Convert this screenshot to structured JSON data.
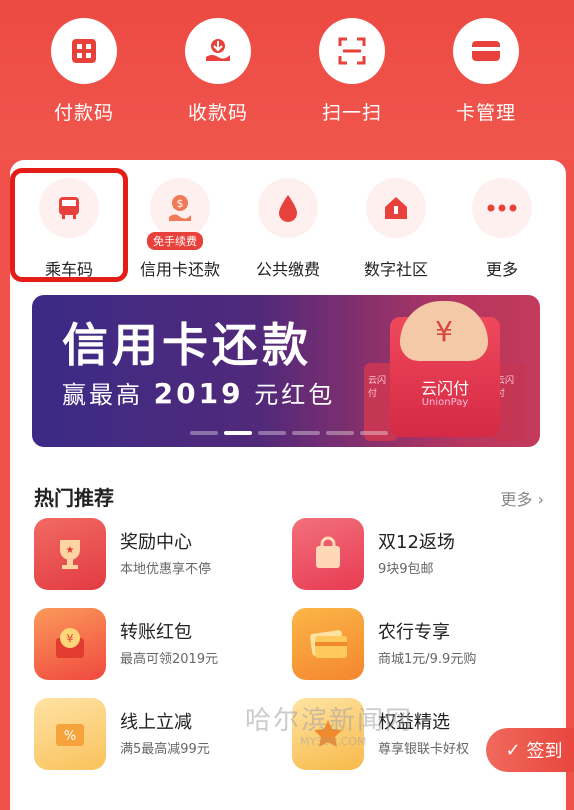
{
  "quick_actions": [
    {
      "label": "付款码",
      "icon": "grid-code-icon"
    },
    {
      "label": "收款码",
      "icon": "hand-receive-icon"
    },
    {
      "label": "扫一扫",
      "icon": "scan-icon"
    },
    {
      "label": "卡管理",
      "icon": "card-icon"
    }
  ],
  "services": [
    {
      "label": "乘车码",
      "icon": "train-icon"
    },
    {
      "label": "信用卡还款",
      "icon": "credit-repay-icon",
      "badge": "免手续费"
    },
    {
      "label": "公共缴费",
      "icon": "water-drop-icon"
    },
    {
      "label": "数字社区",
      "icon": "home-icon"
    },
    {
      "label": "更多",
      "icon": "more-icon"
    }
  ],
  "banner": {
    "title": "信用卡还款",
    "prefix": "赢最高",
    "amount": "2019",
    "suffix": "元红包",
    "brand": "云闪付",
    "brand_sub": "UnionPay",
    "side_brand": "云闪付",
    "active_dot": 1,
    "dot_count": 6
  },
  "section": {
    "title": "热门推荐",
    "more": "更多"
  },
  "recommendations": [
    {
      "title": "奖励中心",
      "desc": "本地优惠享不停",
      "icon": "trophy-icon",
      "color": "#e9434b"
    },
    {
      "title": "双12返场",
      "desc": "9块9包邮",
      "icon": "shopping-bag-icon",
      "color": "#ee4a5c"
    },
    {
      "title": "转账红包",
      "desc": "最高可领2019元",
      "icon": "red-envelope-icon",
      "color": "#f2644a"
    },
    {
      "title": "农行专享",
      "desc": "商城1元/9.9元购",
      "icon": "bank-card-icon",
      "color": "#f6a33a"
    },
    {
      "title": "线上立减",
      "desc": "满5最高减99元",
      "icon": "coupon-icon",
      "color": "#f6c94a"
    },
    {
      "title": "权益精选",
      "desc": "尊享银联卡好权",
      "icon": "benefit-icon",
      "color": "#f7c24a"
    }
  ],
  "signin": {
    "label": "签到"
  },
  "watermark": {
    "text": "哈尔滨新闻网",
    "sub": "MY399.COM"
  },
  "colors": {
    "brand_red": "#ec4a43",
    "highlight_border": "#e51d18"
  }
}
